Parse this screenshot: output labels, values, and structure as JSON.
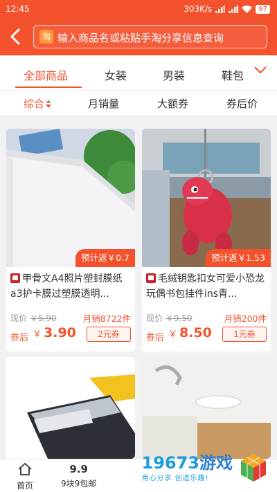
{
  "status_bar": {
    "time": "12:45",
    "speed": "303K/s",
    "battery": "97"
  },
  "header": {
    "search_placeholder": "输入商品名或粘贴手淘分享信息查询",
    "tao_icon": "淘"
  },
  "categories": [
    {
      "label": "全部商品",
      "active": true
    },
    {
      "label": "女装",
      "active": false
    },
    {
      "label": "男装",
      "active": false
    },
    {
      "label": "鞋包",
      "active": false
    }
  ],
  "sort": [
    {
      "label": "综合",
      "active": true
    },
    {
      "label": "月销量",
      "active": false
    },
    {
      "label": "大额券",
      "active": false
    },
    {
      "label": "券后价",
      "active": false
    }
  ],
  "products": [
    {
      "rebate": "预计返￥0.7",
      "title": "甲骨文A4照片塑封膜纸a3护卡膜过塑膜透明...",
      "orig_label": "现价",
      "orig_price": "￥5.90",
      "sales": "月销8722件",
      "after_label": "券后",
      "after_currency": "￥",
      "after_price": "3.90",
      "coupon": "2元券"
    },
    {
      "rebate": "预计返￥1.53",
      "title": "毛绒钥匙扣女可爱小恐龙玩偶书包挂件ins青...",
      "orig_label": "现价",
      "orig_price": "￥9.50",
      "sales": "月销200件",
      "after_label": "券后",
      "after_currency": "￥",
      "after_price": "8.50",
      "coupon": "1元券"
    }
  ],
  "bottom_nav": [
    {
      "label": "首页",
      "icon": "home-icon"
    },
    {
      "label": "9块9包邮",
      "icon_text": "9.9"
    }
  ],
  "watermark": {
    "brand_num": "19673",
    "brand_cn": "游戏",
    "slogan": "用心分享 创造乐趣!"
  },
  "colors": {
    "accent": "#f4512d",
    "background": "#f2f2f2"
  }
}
